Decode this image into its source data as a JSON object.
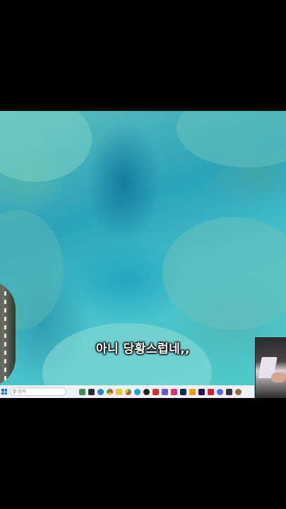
{
  "subtitle": {
    "text": "아니 당황스럽네,,"
  },
  "taskbar": {
    "search_placeholder": "검색",
    "apps": [
      {
        "icon": "landscape-icon",
        "color": "#3b8e5a"
      },
      {
        "icon": "taskview-icon",
        "color": "#2b2b2b"
      },
      {
        "icon": "edge-icon",
        "color": "#1e88c8"
      },
      {
        "icon": "chrome-icon",
        "color": "#e0453a"
      },
      {
        "icon": "folder-icon",
        "color": "#f2c241"
      },
      {
        "icon": "chrome-alt-icon",
        "color": "#3aa757"
      },
      {
        "icon": "app-icon",
        "color": "#1f9fd8"
      },
      {
        "icon": "black-circle-icon",
        "color": "#222222"
      },
      {
        "icon": "red-app-icon",
        "color": "#d93025"
      },
      {
        "icon": "photos-icon",
        "color": "#6a5acd"
      },
      {
        "icon": "instagram-icon",
        "color": "#e1306c"
      },
      {
        "icon": "photoshop-icon",
        "color": "#0a2a52"
      },
      {
        "icon": "illustrator-icon",
        "color": "#ff9a00"
      },
      {
        "icon": "premiere-icon",
        "color": "#2a0a52"
      },
      {
        "icon": "acrobat-icon",
        "color": "#d4202a"
      },
      {
        "icon": "discord-icon",
        "color": "#5865f2"
      },
      {
        "icon": "p-app-icon",
        "color": "#333333"
      },
      {
        "icon": "misc-app-icon",
        "color": "#8a6d3b"
      }
    ]
  }
}
